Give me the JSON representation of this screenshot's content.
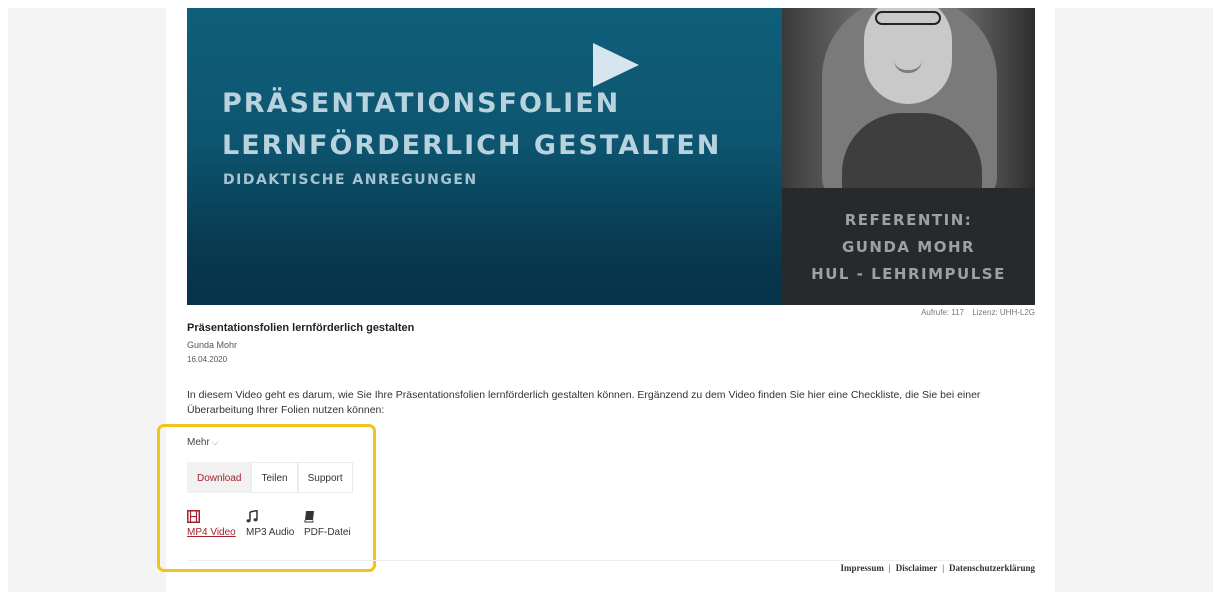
{
  "video": {
    "title_line1": "PRÄSENTATIONSFOLIEN",
    "title_line2": "LERNFÖRDERLICH GESTALTEN",
    "subtitle": "DIDAKTISCHE ANREGUNGEN",
    "referent_label": "REFERENTIN:",
    "referent_name": "GUNDA MOHR",
    "referent_org": "HUL - LEHRIMPULSE"
  },
  "meta": {
    "views": "Aufrufe: 117",
    "license": "Lizenz: UHH-L2G"
  },
  "info": {
    "title": "Präsentationsfolien lernförderlich gestalten",
    "author": "Gunda Mohr",
    "date": "16.04.2020",
    "description": "In diesem Video geht es darum, wie Sie Ihre Präsentationsfolien lernförderlich gestalten können. Ergänzend zu dem Video finden Sie hier eine Checkliste, die Sie bei einer Überarbeitung Ihrer Folien nutzen können:"
  },
  "more_label": "Mehr",
  "tabs": [
    {
      "label": "Download"
    },
    {
      "label": "Teilen"
    },
    {
      "label": "Support"
    }
  ],
  "downloads": [
    {
      "label": "MP4 Video",
      "icon": "film-icon"
    },
    {
      "label": "MP3 Audio",
      "icon": "music-note-icon"
    },
    {
      "label": "PDF-Datei",
      "icon": "book-icon"
    }
  ],
  "footer": {
    "impressum": "Impressum",
    "disclaimer": "Disclaimer",
    "privacy": "Datenschutzerklärung",
    "separator": "|"
  },
  "colors": {
    "accent": "#a3222d",
    "highlight_border": "#f0c419"
  }
}
